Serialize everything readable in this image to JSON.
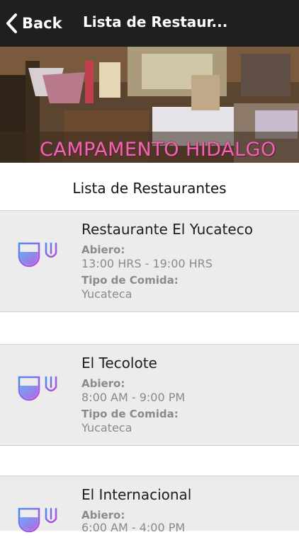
{
  "header": {
    "back_label": "Back",
    "title": "Lista de Restaur..."
  },
  "banner": {
    "text": "CAMPAMENTO HIDALGO"
  },
  "section_title": "Lista de Restaurantes",
  "restaurants": [
    {
      "name": "Restaurante El Yucateco",
      "hours_label": "Abiero:",
      "hours": "13:00 HRS - 19:00 HRS",
      "type_label": "Tipo de Comida:",
      "type": "Yucateca",
      "icon": "wine-glass-fork-icon"
    },
    {
      "name": "El Tecolote",
      "hours_label": "Abiero:",
      "hours": "8:00 AM - 9:00 PM",
      "type_label": "Tipo de Comida:",
      "type": "Yucateca",
      "icon": "wine-glass-fork-icon"
    },
    {
      "name": "El Internacional",
      "hours_label": "Abiero:",
      "hours": "6:00 AM - 4:00 PM",
      "icon": "wine-glass-fork-icon"
    }
  ],
  "colors": {
    "header_bg": "#1f1f1f",
    "card_bg": "#ececec",
    "banner_text": "#e86aa8",
    "icon_gradient_start": "#4a8cf0",
    "icon_gradient_end": "#c54ad8"
  }
}
